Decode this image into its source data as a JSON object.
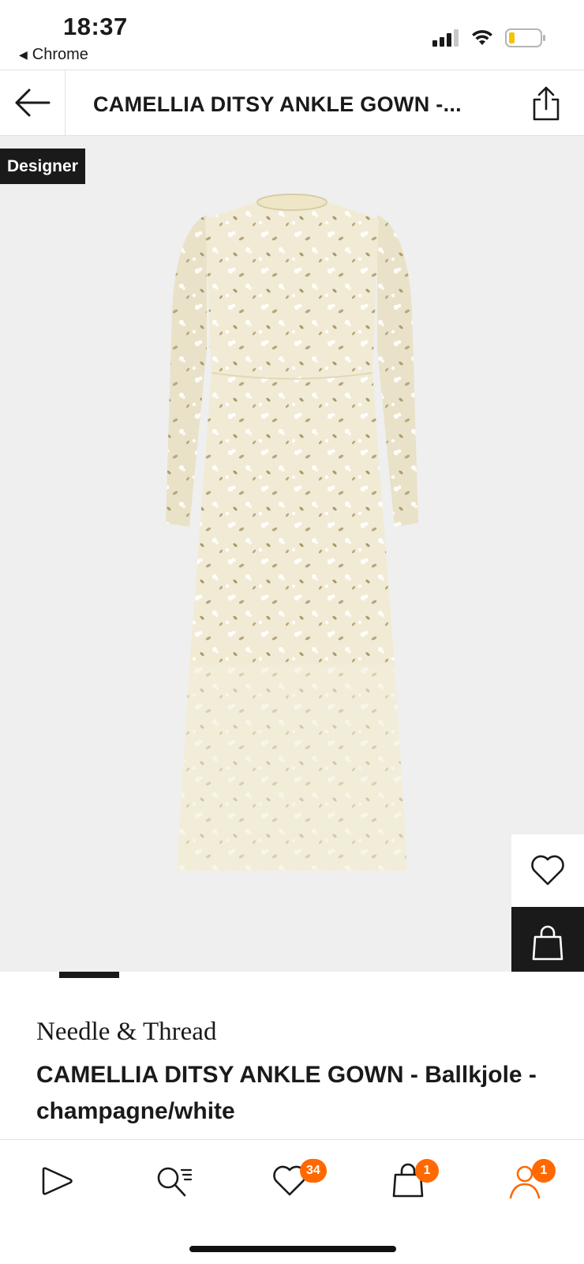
{
  "status_bar": {
    "time": "18:37",
    "back_app": "Chrome",
    "signal_icon": "cellular-signal-icon",
    "wifi_icon": "wifi-icon",
    "battery_icon": "battery-low-icon"
  },
  "header": {
    "title": "CAMELLIA DITSY ANKLE GOWN -...",
    "back_icon": "arrow-left-icon",
    "share_icon": "share-icon"
  },
  "hero": {
    "badge": "Designer",
    "image_alt": "dress-image",
    "favorite_icon": "heart-icon",
    "add_to_bag_icon": "shopping-bag-icon",
    "gallery_position": 1
  },
  "product": {
    "brand": "Needle & Thread",
    "name": "CAMELLIA DITSY ANKLE GOWN - Ballkjole - champagne/white"
  },
  "bottom_nav": {
    "items": [
      {
        "id": "home",
        "icon": "play-home-icon"
      },
      {
        "id": "search",
        "icon": "search-list-icon"
      },
      {
        "id": "wishlist",
        "icon": "heart-icon",
        "badge": "34"
      },
      {
        "id": "bag",
        "icon": "shopping-bag-icon",
        "badge": "1"
      },
      {
        "id": "account",
        "icon": "user-icon",
        "badge": "1",
        "active": true
      }
    ]
  },
  "colors": {
    "accent": "#ff6900",
    "dark": "#1a1a1a",
    "hero_bg": "#efefef"
  }
}
